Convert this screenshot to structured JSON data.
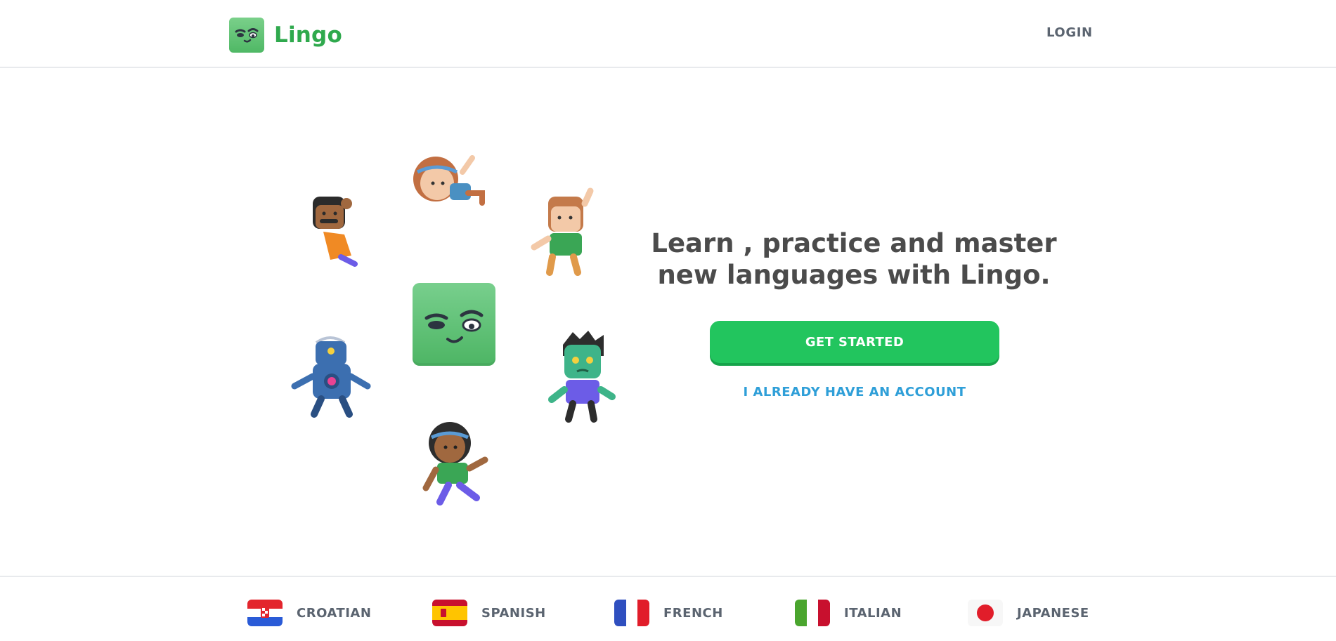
{
  "header": {
    "brand_name": "Lingo",
    "login_label": "LOGIN"
  },
  "hero": {
    "headline": "Learn , practice and master new languages with Lingo.",
    "primary_cta": "GET STARTED",
    "secondary_cta": "I ALREADY HAVE AN ACCOUNT",
    "illustrations": [
      "mustache-character",
      "girl-character",
      "boy-character",
      "robot-character",
      "zombie-character",
      "kid-character"
    ]
  },
  "footer": {
    "languages": [
      {
        "label": "CROATIAN",
        "flag": "croatia-flag-icon"
      },
      {
        "label": "SPANISH",
        "flag": "spain-flag-icon"
      },
      {
        "label": "FRENCH",
        "flag": "france-flag-icon"
      },
      {
        "label": "ITALIAN",
        "flag": "italy-flag-icon"
      },
      {
        "label": "JAPANESE",
        "flag": "japan-flag-icon"
      }
    ]
  },
  "colors": {
    "brand": "#2fa94d",
    "primary_button": "#22c55e",
    "link": "#2f9fd8",
    "text": "#4b4b4b"
  }
}
